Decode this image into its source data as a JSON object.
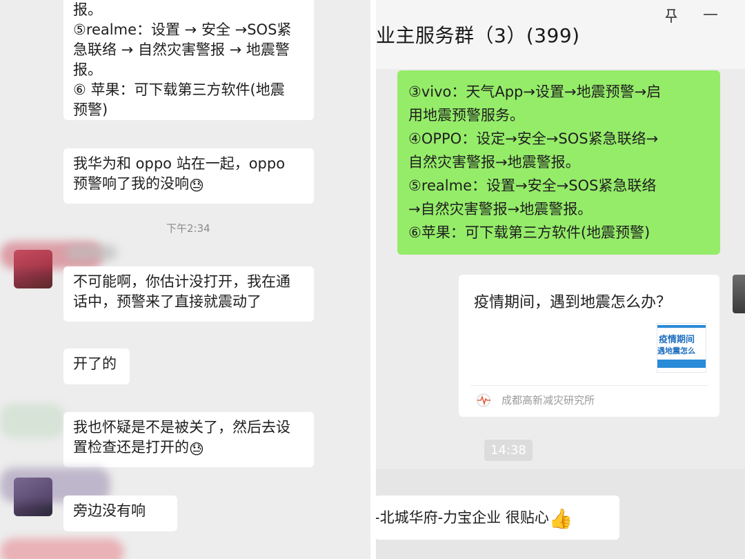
{
  "left": {
    "messages": [
      {
        "lines": [
          "报。",
          "⑤realme：设置 → 安全 →SOS紧",
          "急联络 → 自然灾害警报 → 地震警",
          "报。",
          "⑥ 苹果：可下载第三方软件(地震",
          "预警)"
        ]
      },
      {
        "lines": [
          "我华为和 oppo 站在一起，oppo",
          "预警响了我的没响"
        ],
        "emoji": "😓"
      },
      {
        "lines": [
          "不可能啊，你估计没打开，我在通",
          "话中，预警来了直接就震动了"
        ]
      },
      {
        "lines": [
          "开了的"
        ]
      },
      {
        "lines": [
          "我也怀疑是不是被关了，然后去设",
          "置检查还是打开的"
        ],
        "emoji": "😓"
      },
      {
        "lines": [
          "旁边没有响"
        ]
      }
    ],
    "timestamp": "下午2:34"
  },
  "right": {
    "title": "业主服务群（3）(399)",
    "green_message": {
      "lines": [
        "③vivo：天气App→设置→地震预警→启",
        "用地震预警服务。",
        "④OPPO：设定→安全→SOS紧急联络→",
        "自然灾害警报→地震警报。",
        "⑤realme：设置→安全→SOS紧急联络",
        "→自然灾害警报→地震警报。",
        "⑥苹果：可下载第三方软件(地震预警)"
      ]
    },
    "card": {
      "title": "疫情期间，遇到地震怎么办？",
      "thumb_text_1": "疫情期间",
      "thumb_text_2": "遇地震怎么",
      "source": "成都高新减灾研究所"
    },
    "timestamp": "14:38",
    "bottom_message": "-北城华府-力宝企业 很贴心",
    "bottom_emoji": "👍",
    "colors": {
      "bubble_green": "#95ec69",
      "left_bg": "#ededed",
      "right_bg": "#ececec"
    }
  }
}
